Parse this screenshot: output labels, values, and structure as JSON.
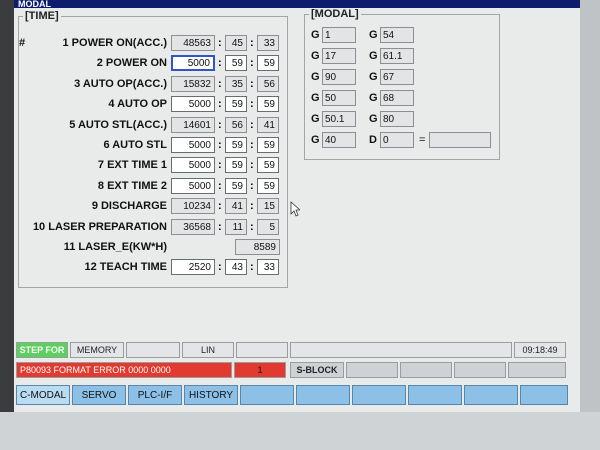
{
  "window_title": "MODAL",
  "time_panel": {
    "label": "[TIME]",
    "rows": [
      {
        "hash": "#",
        "label": "1 POWER ON(ACC.)",
        "v1": "48563",
        "v2": "45",
        "v3": "33"
      },
      {
        "label": "2 POWER ON",
        "v1": "5000",
        "v2": "59",
        "v3": "59"
      },
      {
        "label": "3 AUTO OP(ACC.)",
        "v1": "15832",
        "v2": "35",
        "v3": "56"
      },
      {
        "label": "4 AUTO OP",
        "v1": "5000",
        "v2": "59",
        "v3": "59"
      },
      {
        "label": "5 AUTO STL(ACC.)",
        "v1": "14601",
        "v2": "56",
        "v3": "41"
      },
      {
        "label": "6 AUTO STL",
        "v1": "5000",
        "v2": "59",
        "v3": "59"
      },
      {
        "label": "7 EXT TIME 1",
        "v1": "5000",
        "v2": "59",
        "v3": "59"
      },
      {
        "label": "8 EXT TIME 2",
        "v1": "5000",
        "v2": "59",
        "v3": "59"
      },
      {
        "label": "9 DISCHARGE",
        "v1": "10234",
        "v2": "41",
        "v3": "15"
      },
      {
        "label": "10 LASER PREPARATION",
        "v1": "36568",
        "v2": "11",
        "v3": "5"
      },
      {
        "label": "11 LASER_E(KW*H)",
        "value": "8589"
      },
      {
        "label": "12 TEACH TIME",
        "v1": "2520",
        "v2": "43",
        "v3": "33"
      }
    ],
    "separator": ":"
  },
  "modal_panel": {
    "label": "[MODAL]",
    "left": [
      {
        "prefix": "G",
        "value": "1"
      },
      {
        "prefix": "G",
        "value": "17"
      },
      {
        "prefix": "G",
        "value": "90"
      },
      {
        "prefix": "G",
        "value": "50"
      },
      {
        "prefix": "G",
        "value": "50.1"
      },
      {
        "prefix": "G",
        "value": "40"
      }
    ],
    "right": [
      {
        "prefix": "G",
        "value": "54"
      },
      {
        "prefix": "G",
        "value": "61.1"
      },
      {
        "prefix": "G",
        "value": "67"
      },
      {
        "prefix": "G",
        "value": "68"
      },
      {
        "prefix": "G",
        "value": "80"
      },
      {
        "prefix": "D",
        "value": "0"
      }
    ],
    "equals": "="
  },
  "status_bar": {
    "mode": "STEP FOR",
    "memory": "MEMORY",
    "lin": "LIN",
    "clock": "09:18:49"
  },
  "message_bar": {
    "error": "P80093 FORMAT ERROR 0000 0000",
    "count": "1",
    "sblock": "S-BLOCK"
  },
  "softkeys": [
    "C-MODAL",
    "SERVO",
    "PLC-I/F",
    "HISTORY"
  ],
  "colors": {
    "title_bar": "#0e1c6e",
    "step_for_green": "#5cd05c",
    "error_red": "#e23a2e",
    "softkey_blue": "#8cc0e6",
    "selection_blue": "#2f56c8"
  }
}
